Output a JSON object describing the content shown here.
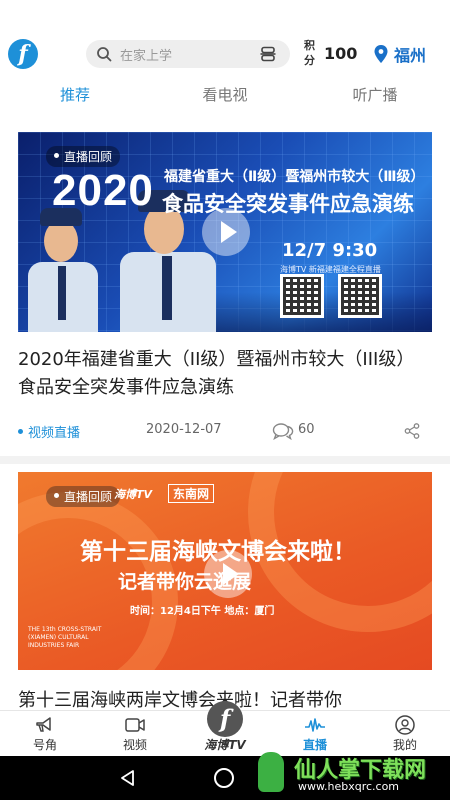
{
  "header": {
    "search_placeholder": "在家上学",
    "points_label": "积分",
    "points_value": "100",
    "city": "福州"
  },
  "tabs": [
    {
      "label": "推荐",
      "active": true
    },
    {
      "label": "看电视",
      "active": false
    },
    {
      "label": "听广播",
      "active": false
    }
  ],
  "colors": {
    "accent": "#1e90d8",
    "city": "#1a70c8"
  },
  "feed": [
    {
      "badge": "直播回顾",
      "thumb_year": "2020",
      "thumb_line1": "福建省重大（Ⅱ级）暨福州市较大（Ⅲ级）",
      "thumb_line2": "食品安全突发事件应急演练",
      "thumb_datetime": "12/7   9:30",
      "thumb_sub": "海博TV  新福建福建全程直播",
      "title": "2020年福建省重大（II级）暨福州市较大（III级）食品安全突发事件应急演练",
      "tag": "视频直播",
      "date": "2020-12-07",
      "comments": "60"
    },
    {
      "badge": "直播回顾",
      "thumb_brand": "海博TV",
      "thumb_brand2": "东南网",
      "thumb_line1": "第十三届海峡文博会来啦！",
      "thumb_line2": "记者带你云逛展",
      "thumb_info": "时间：12月4日下午   地点：厦门",
      "thumb_eng": "THE 13th CROSS-STRAIT (XIAMEN) CULTURAL INDUSTRIES FAIR",
      "title": "第十三届海峡两岸文博会来啦！记者带你"
    }
  ],
  "bottom_nav": [
    {
      "label": "号角",
      "icon": "horn-icon"
    },
    {
      "label": "视频",
      "icon": "video-icon"
    },
    {
      "label": "海博TV",
      "icon": "haibo-logo-icon"
    },
    {
      "label": "直播",
      "icon": "live-icon",
      "active": true
    },
    {
      "label": "我的",
      "icon": "profile-icon"
    }
  ],
  "watermark": {
    "title": "仙人掌下载网",
    "url": "www.hebxqrc.com"
  }
}
